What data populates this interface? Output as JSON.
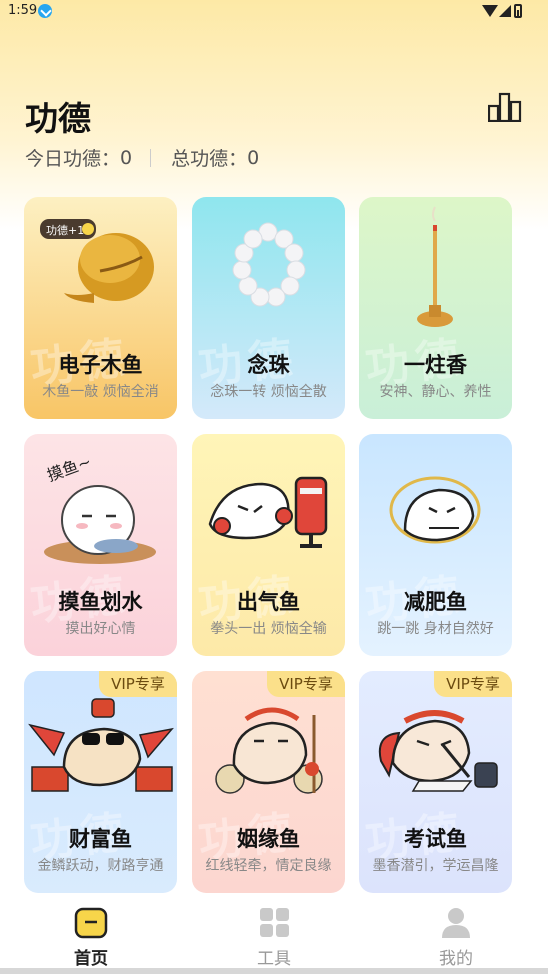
{
  "status_bar": {
    "time": "1:59"
  },
  "header": {
    "title": "功德",
    "today_label": "今日功德：",
    "today_value": "0",
    "total_label": "总功德：",
    "total_value": "0"
  },
  "cards": [
    {
      "name": "电子木鱼",
      "desc": "木鱼一敲 烦恼全消",
      "badge": "功德+1",
      "watermark": "功德",
      "vip": ""
    },
    {
      "name": "念珠",
      "desc": "念珠一转 烦恼全散",
      "watermark": "功德",
      "vip": ""
    },
    {
      "name": "一炷香",
      "desc": "安神、静心、养性",
      "watermark": "功德",
      "vip": ""
    },
    {
      "name": "摸鱼划水",
      "desc": "摸出好心情",
      "badge": "摸鱼~",
      "watermark": "功德",
      "vip": ""
    },
    {
      "name": "出气鱼",
      "desc": "拳头一出 烦恼全输",
      "watermark": "功德",
      "vip": ""
    },
    {
      "name": "减肥鱼",
      "desc": "跳一跳 身材自然好",
      "watermark": "功德",
      "vip": ""
    },
    {
      "name": "财富鱼",
      "desc": "金鳞跃动，财路亨通",
      "watermark": "功德",
      "vip": "VIP专享"
    },
    {
      "name": "姻缘鱼",
      "desc": "红线轻牵，情定良缘",
      "watermark": "功德",
      "vip": "VIP专享"
    },
    {
      "name": "考试鱼",
      "desc": "墨香潜引，学运昌隆",
      "watermark": "功德",
      "vip": "VIP专享"
    }
  ],
  "nav": [
    {
      "label": "首页",
      "icon": "home-icon",
      "active": true
    },
    {
      "label": "工具",
      "icon": "grid-icon",
      "active": false
    },
    {
      "label": "我的",
      "icon": "person-icon",
      "active": false
    }
  ],
  "colors": {
    "card_backgrounds": [
      [
        "#fde8a8",
        "#f9c66a"
      ],
      [
        "#a8ecef",
        "#cfe7f8"
      ],
      [
        "#d9f5c6",
        "#cef0d4"
      ],
      [
        "#fde1e4",
        "#fbd2d8"
      ],
      [
        "#fff6bf",
        "#fdecae"
      ],
      [
        "#d3ebff",
        "#e5f3ff"
      ],
      [
        "#d7eaff",
        "#cfe4fb"
      ],
      [
        "#ffe3d7",
        "#fdd7cf"
      ],
      [
        "#e7edff",
        "#dfe5fd"
      ]
    ],
    "accent": "#f7d54a"
  }
}
